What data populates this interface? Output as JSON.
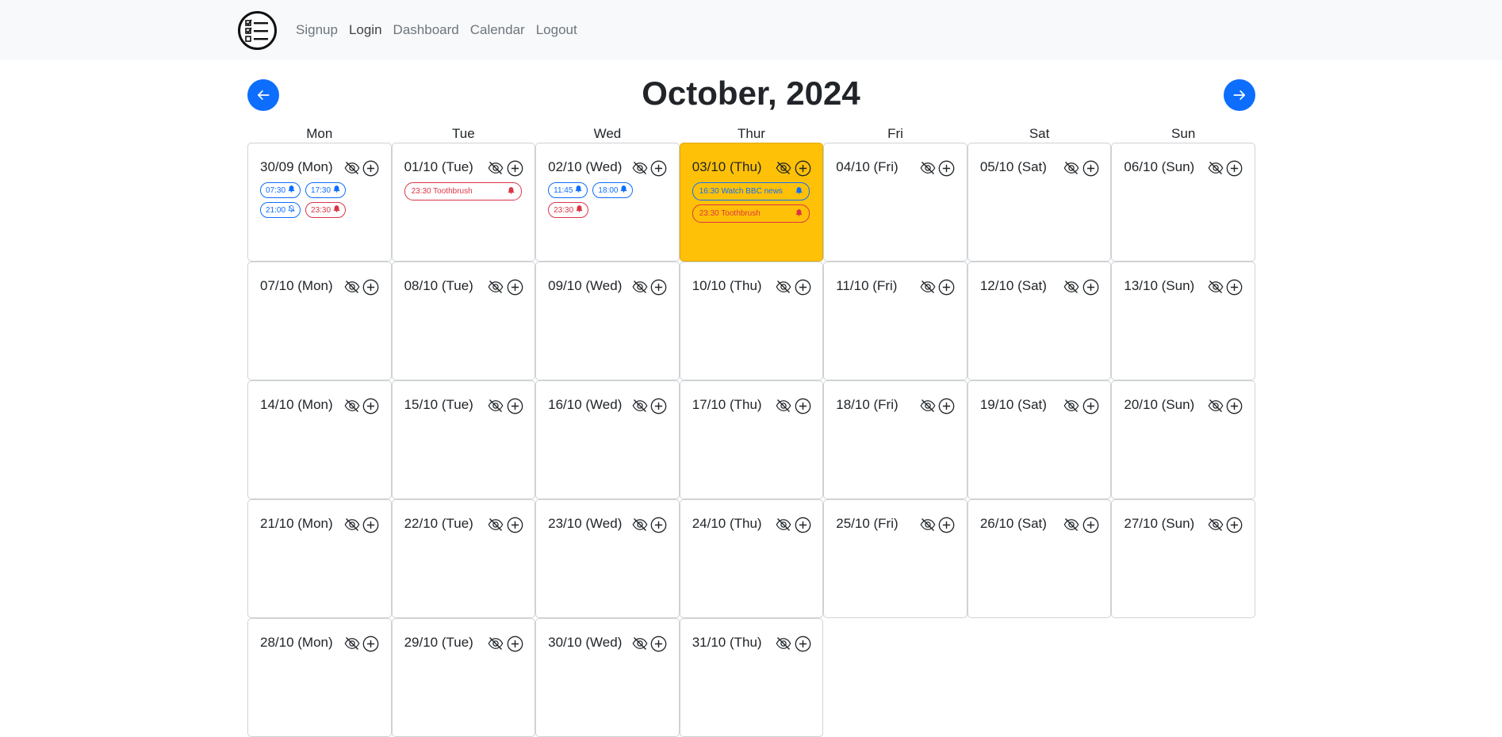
{
  "nav": {
    "links": [
      "Signup",
      "Login",
      "Dashboard",
      "Calendar",
      "Logout"
    ]
  },
  "header": {
    "title": "October, 2024"
  },
  "weekdays": [
    "Mon",
    "Tue",
    "Wed",
    "Thur",
    "Fri",
    "Sat",
    "Sun"
  ],
  "colors": {
    "primary": "#0d6efd",
    "danger": "#dc3545",
    "today": "#ffc107"
  },
  "days": [
    {
      "label": "30/09 (Mon)",
      "today": false,
      "events": [
        {
          "text": "07:30",
          "color": "blue",
          "icon": "bell-icon"
        },
        {
          "text": "17:30",
          "color": "blue",
          "icon": "bell-icon"
        },
        {
          "text": "21:00",
          "color": "blue",
          "icon": "bell-off-icon"
        },
        {
          "text": "23:30",
          "color": "red",
          "icon": "bell-icon"
        }
      ]
    },
    {
      "label": "01/10 (Tue)",
      "today": false,
      "events": [
        {
          "text": "23:30 Toothbrush",
          "color": "red",
          "icon": "bell-icon",
          "wide": true
        }
      ]
    },
    {
      "label": "02/10 (Wed)",
      "today": false,
      "events": [
        {
          "text": "11:45",
          "color": "blue",
          "icon": "bell-icon"
        },
        {
          "text": "18:00",
          "color": "blue",
          "icon": "bell-icon"
        },
        {
          "text": "23:30",
          "color": "red",
          "icon": "bell-icon"
        }
      ]
    },
    {
      "label": "03/10 (Thu)",
      "today": true,
      "events": [
        {
          "text": "16:30 Watch BBC news",
          "color": "blue",
          "icon": "bell-icon",
          "wide": true
        },
        {
          "text": "23:30 Toothbrush",
          "color": "red",
          "icon": "bell-icon",
          "wide": true
        }
      ]
    },
    {
      "label": "04/10 (Fri)",
      "today": false,
      "events": []
    },
    {
      "label": "05/10 (Sat)",
      "today": false,
      "events": []
    },
    {
      "label": "06/10 (Sun)",
      "today": false,
      "events": []
    },
    {
      "label": "07/10 (Mon)",
      "today": false,
      "events": []
    },
    {
      "label": "08/10 (Tue)",
      "today": false,
      "events": []
    },
    {
      "label": "09/10 (Wed)",
      "today": false,
      "events": []
    },
    {
      "label": "10/10 (Thu)",
      "today": false,
      "events": []
    },
    {
      "label": "11/10 (Fri)",
      "today": false,
      "events": []
    },
    {
      "label": "12/10 (Sat)",
      "today": false,
      "events": []
    },
    {
      "label": "13/10 (Sun)",
      "today": false,
      "events": []
    },
    {
      "label": "14/10 (Mon)",
      "today": false,
      "events": []
    },
    {
      "label": "15/10 (Tue)",
      "today": false,
      "events": []
    },
    {
      "label": "16/10 (Wed)",
      "today": false,
      "events": []
    },
    {
      "label": "17/10 (Thu)",
      "today": false,
      "events": []
    },
    {
      "label": "18/10 (Fri)",
      "today": false,
      "events": []
    },
    {
      "label": "19/10 (Sat)",
      "today": false,
      "events": []
    },
    {
      "label": "20/10 (Sun)",
      "today": false,
      "events": []
    },
    {
      "label": "21/10 (Mon)",
      "today": false,
      "events": []
    },
    {
      "label": "22/10 (Tue)",
      "today": false,
      "events": []
    },
    {
      "label": "23/10 (Wed)",
      "today": false,
      "events": []
    },
    {
      "label": "24/10 (Thu)",
      "today": false,
      "events": []
    },
    {
      "label": "25/10 (Fri)",
      "today": false,
      "events": []
    },
    {
      "label": "26/10 (Sat)",
      "today": false,
      "events": []
    },
    {
      "label": "27/10 (Sun)",
      "today": false,
      "events": []
    },
    {
      "label": "28/10 (Mon)",
      "today": false,
      "events": []
    },
    {
      "label": "29/10 (Tue)",
      "today": false,
      "events": []
    },
    {
      "label": "30/10 (Wed)",
      "today": false,
      "events": []
    },
    {
      "label": "31/10 (Thu)",
      "today": false,
      "events": []
    }
  ]
}
